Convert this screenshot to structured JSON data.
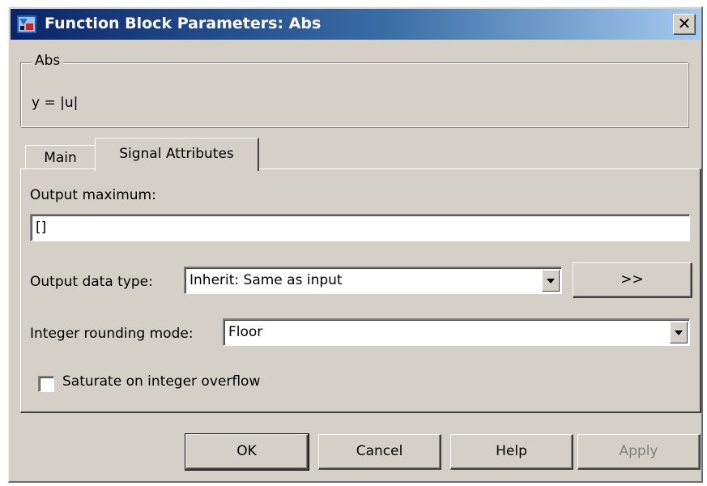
{
  "window": {
    "title": "Function Block Parameters: Abs",
    "close_glyph": "✕"
  },
  "block": {
    "group_label": "Abs",
    "description": "y = |u|"
  },
  "tabs": [
    {
      "label": "Main",
      "selected": false
    },
    {
      "label": "Signal Attributes",
      "selected": true
    }
  ],
  "signal_attributes": {
    "output_maximum": {
      "label": "Output maximum:",
      "value": "[]"
    },
    "output_data_type": {
      "label": "Output data type:",
      "value": "Inherit: Same as input",
      "assistant_button": ">>"
    },
    "integer_rounding_mode": {
      "label": "Integer rounding mode:",
      "value": "Floor"
    },
    "saturate": {
      "label": "Saturate on integer overflow",
      "checked": false
    }
  },
  "buttons": {
    "ok": "OK",
    "cancel": "Cancel",
    "help": "Help",
    "apply": "Apply"
  },
  "colors": {
    "face": "#d4d0c8",
    "title_start": "#0a246a",
    "title_end": "#a6caf0",
    "disabled_text": "#808080"
  }
}
